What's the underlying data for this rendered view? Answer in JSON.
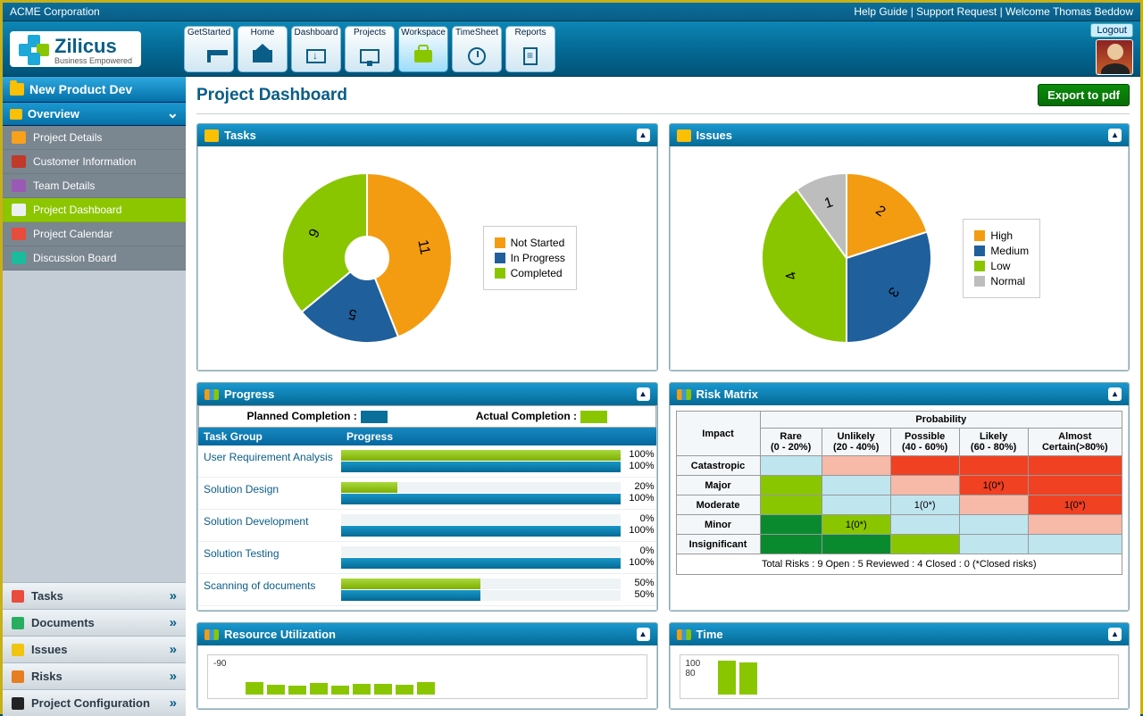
{
  "topbar": {
    "corp": "ACME Corporation",
    "help": "Help Guide",
    "support": "Support Request",
    "welcome": "Welcome Thomas Beddow"
  },
  "brand": {
    "name": "Zilicus",
    "tagline": "Business Empowered"
  },
  "nav": [
    {
      "label": "GetStarted"
    },
    {
      "label": "Home"
    },
    {
      "label": "Dashboard"
    },
    {
      "label": "Projects"
    },
    {
      "label": "Workspace",
      "active": true
    },
    {
      "label": "TimeSheet"
    },
    {
      "label": "Reports"
    }
  ],
  "logout": "Logout",
  "sidebar": {
    "project": "New Product Dev",
    "section": "Overview",
    "items": [
      {
        "label": "Project Details",
        "color": "#f8a11a"
      },
      {
        "label": "Customer Information",
        "color": "#c0392b"
      },
      {
        "label": "Team Details",
        "color": "#9b59b6"
      },
      {
        "label": "Project Dashboard",
        "color": "#ecf0f1",
        "active": true
      },
      {
        "label": "Project Calendar",
        "color": "#e74c3c"
      },
      {
        "label": "Discussion Board",
        "color": "#1abc9c"
      }
    ],
    "bottom": [
      {
        "label": "Tasks",
        "color": "#e74c3c"
      },
      {
        "label": "Documents",
        "color": "#27ae60"
      },
      {
        "label": "Issues",
        "color": "#f1c40f"
      },
      {
        "label": "Risks",
        "color": "#e67e22"
      },
      {
        "label": "Project Configuration",
        "color": "#222"
      }
    ]
  },
  "page": {
    "title": "Project Dashboard",
    "export": "Export to pdf"
  },
  "panels": {
    "tasks": "Tasks",
    "issues": "Issues",
    "progress": "Progress",
    "risk": "Risk Matrix",
    "resource": "Resource Utilization",
    "time": "Time"
  },
  "progressLegend": {
    "planned": "Planned Completion :",
    "actual": "Actual Completion :"
  },
  "progressHead": {
    "c1": "Task Group",
    "c2": "Progress"
  },
  "progressRows": [
    {
      "name": "User Requirement Analysis",
      "planned": 100,
      "actual": 100
    },
    {
      "name": "Solution Design",
      "planned": 20,
      "actual": 100
    },
    {
      "name": "Solution Development",
      "planned": 0,
      "actual": 100
    },
    {
      "name": "Solution Testing",
      "planned": 0,
      "actual": 100
    },
    {
      "name": "Scanning of documents",
      "planned": 50,
      "actual": 50
    }
  ],
  "riskHead": {
    "prob": "Probability",
    "impact": "Impact",
    "cols": [
      "Rare\n(0 - 20%)",
      "Unlikely\n(20 - 40%)",
      "Possible\n(40 - 60%)",
      "Likely\n(60 - 80%)",
      "Almost\nCertain(>80%)"
    ],
    "rows": [
      "Catastropic",
      "Major",
      "Moderate",
      "Minor",
      "Insignificant"
    ]
  },
  "riskCells": {
    "Major_Likely": "1(0*)",
    "Moderate_Possible": "1(0*)",
    "Moderate_Almost": "1(0*)",
    "Minor_Unlikely": "1(0*)"
  },
  "riskFoot": "Total Risks : 9 Open : 5 Reviewed : 4 Closed : 0   (*Closed risks)",
  "resourceY": "-90",
  "timeY": "100\n80",
  "chart_data": [
    {
      "type": "pie",
      "title": "Tasks",
      "categories": [
        "Not Started",
        "In Progress",
        "Completed"
      ],
      "values": [
        11,
        5,
        9
      ],
      "colors": [
        "#f39c12",
        "#1f5f9c",
        "#8ac600"
      ]
    },
    {
      "type": "pie",
      "title": "Issues",
      "categories": [
        "High",
        "Medium",
        "Low",
        "Normal"
      ],
      "values": [
        2,
        3,
        4,
        1
      ],
      "colors": [
        "#f39c12",
        "#1f5f9c",
        "#8ac600",
        "#bdbdbd"
      ]
    },
    {
      "type": "bar",
      "title": "Progress",
      "categories": [
        "User Requirement Analysis",
        "Solution Design",
        "Solution Development",
        "Solution Testing",
        "Scanning of documents"
      ],
      "series": [
        {
          "name": "Planned Completion",
          "values": [
            100,
            20,
            0,
            0,
            50
          ],
          "color": "#8ac600"
        },
        {
          "name": "Actual Completion",
          "values": [
            100,
            100,
            100,
            100,
            50
          ],
          "color": "#0a6e9a"
        }
      ],
      "xlabel": "",
      "ylabel": "%",
      "ylim": [
        0,
        100
      ]
    }
  ]
}
